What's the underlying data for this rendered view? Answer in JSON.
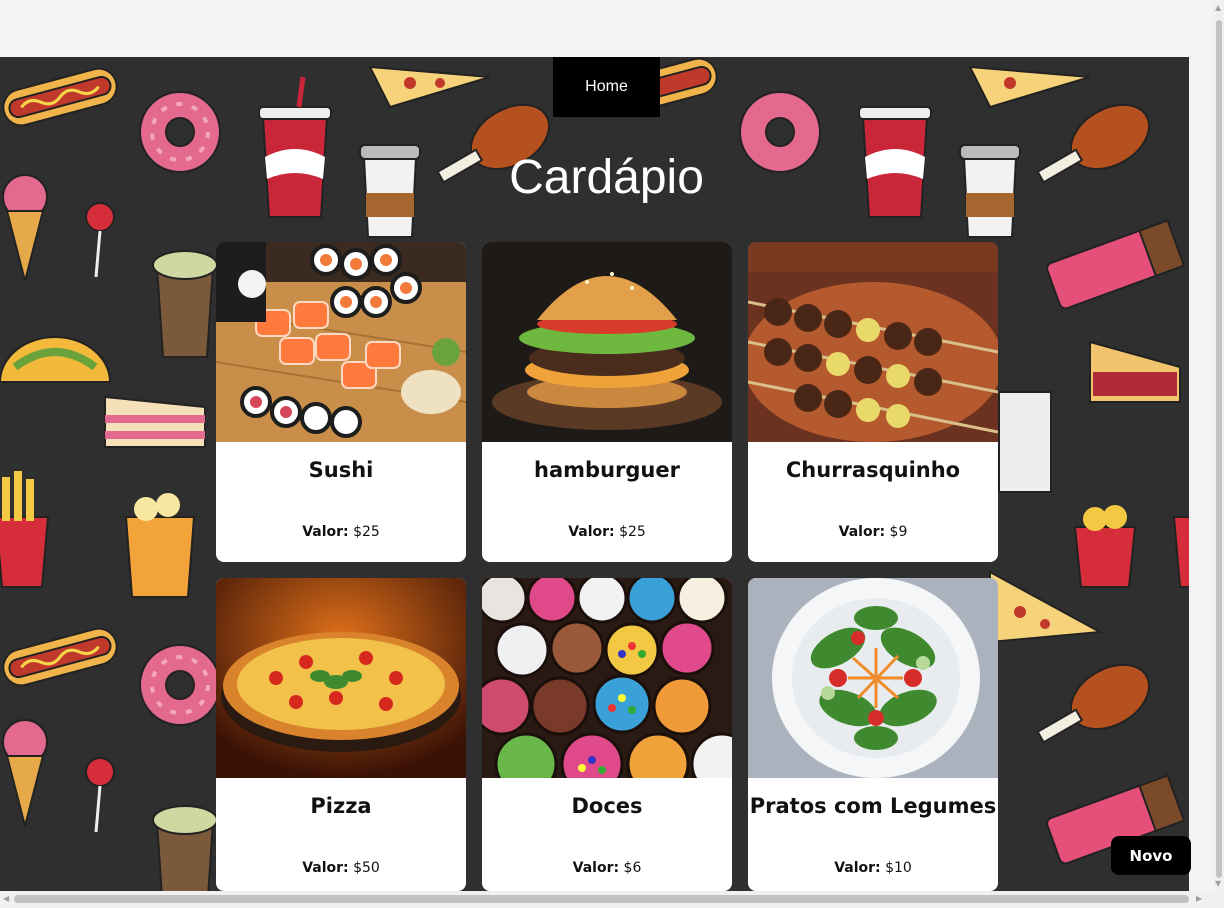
{
  "nav": {
    "home_label": "Home"
  },
  "page": {
    "title": "Cardápio"
  },
  "price_label": "Valor:",
  "items": [
    {
      "name": "Sushi",
      "price": "$25",
      "image_icon": "sushi-image"
    },
    {
      "name": "hamburguer",
      "price": "$25",
      "image_icon": "burger-image"
    },
    {
      "name": "Churrasquinho",
      "price": "$9",
      "image_icon": "skewer-image"
    },
    {
      "name": "Pizza",
      "price": "$50",
      "image_icon": "pizza-image"
    },
    {
      "name": "Doces",
      "price": "$6",
      "image_icon": "sweets-image"
    },
    {
      "name": "Pratos com Legumes",
      "price": "$10",
      "image_icon": "salad-image"
    }
  ],
  "actions": {
    "novo_label": "Novo"
  },
  "colors": {
    "background": "#2f2f2f",
    "button": "#000000",
    "card": "#ffffff"
  }
}
